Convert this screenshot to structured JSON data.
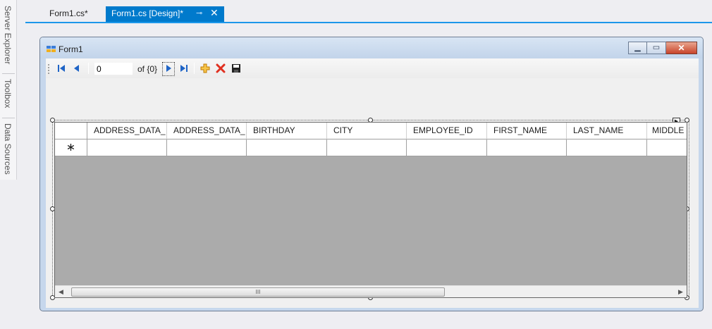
{
  "side_panel": {
    "tabs": [
      {
        "label": "Server Explorer"
      },
      {
        "label": "Toolbox"
      },
      {
        "label": "Data Sources"
      }
    ]
  },
  "tabs": [
    {
      "label": "Form1.cs*",
      "active": false
    },
    {
      "label": "Form1.cs [Design]*",
      "active": true,
      "pin_icon": "pin-icon",
      "close_icon": "close-icon"
    }
  ],
  "form": {
    "title": "Form1",
    "icon": "form-icon",
    "window_buttons": [
      "minimize",
      "maximize",
      "close"
    ]
  },
  "navigator": {
    "position_value": "0",
    "count_label": "of {0}",
    "buttons": [
      "move-first",
      "move-previous",
      "move-next",
      "move-last",
      "add-new",
      "delete",
      "save"
    ]
  },
  "grid": {
    "columns": [
      "ADDRESS_DATA_",
      "ADDRESS_DATA_",
      "BIRTHDAY",
      "CITY",
      "EMPLOYEE_ID",
      "FIRST_NAME",
      "LAST_NAME",
      "MIDDLE"
    ],
    "new_row_marker": "∗",
    "scroll_grip": "III"
  },
  "colors": {
    "accent": "#007acc",
    "tab_underline": "#1c97ea",
    "grid_background": "#ababab",
    "nav_icon_blue": "#1f64c6",
    "add_icon": "#f3a300",
    "delete_icon": "#e03020"
  }
}
